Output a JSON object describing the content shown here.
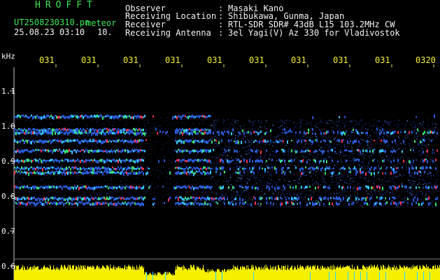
{
  "header": {
    "title": "HROFFT",
    "file_name": "UT2508230310.pn",
    "file_type": "meteor",
    "date_time": "25.08.23 03:10",
    "duration": "10."
  },
  "info": [
    {
      "label": "Observer",
      "sep": ":",
      "value": "Masaki Kano"
    },
    {
      "label": "Receiving Location",
      "sep": ":",
      "value": "Shibukawa, Gunma, Japan"
    },
    {
      "label": "Receiver",
      "sep": ":",
      "value": "RTL-SDR SDR# 43dB L15 103.2MHz CW"
    },
    {
      "label": "Receiving Antenna",
      "sep": ":",
      "value": "3el Yagi(V) Az 330 for Vladivostok"
    }
  ],
  "axis": {
    "y_unit": "kHz",
    "y_ticks": [
      "1.1",
      "1.0",
      "0.9",
      "0.8",
      "0.7",
      "0.6"
    ],
    "x_ticks": [
      "031",
      "031",
      "031",
      "031",
      "031",
      "031",
      "031",
      "031",
      "031",
      "0320"
    ]
  },
  "colors": {
    "header_green": "#3ee85a",
    "tick_yellow": "#f7f23a",
    "signal_blue": "#2a5bd8",
    "signal_red": "#ff3050",
    "level_yellow": "#f4f000"
  }
}
